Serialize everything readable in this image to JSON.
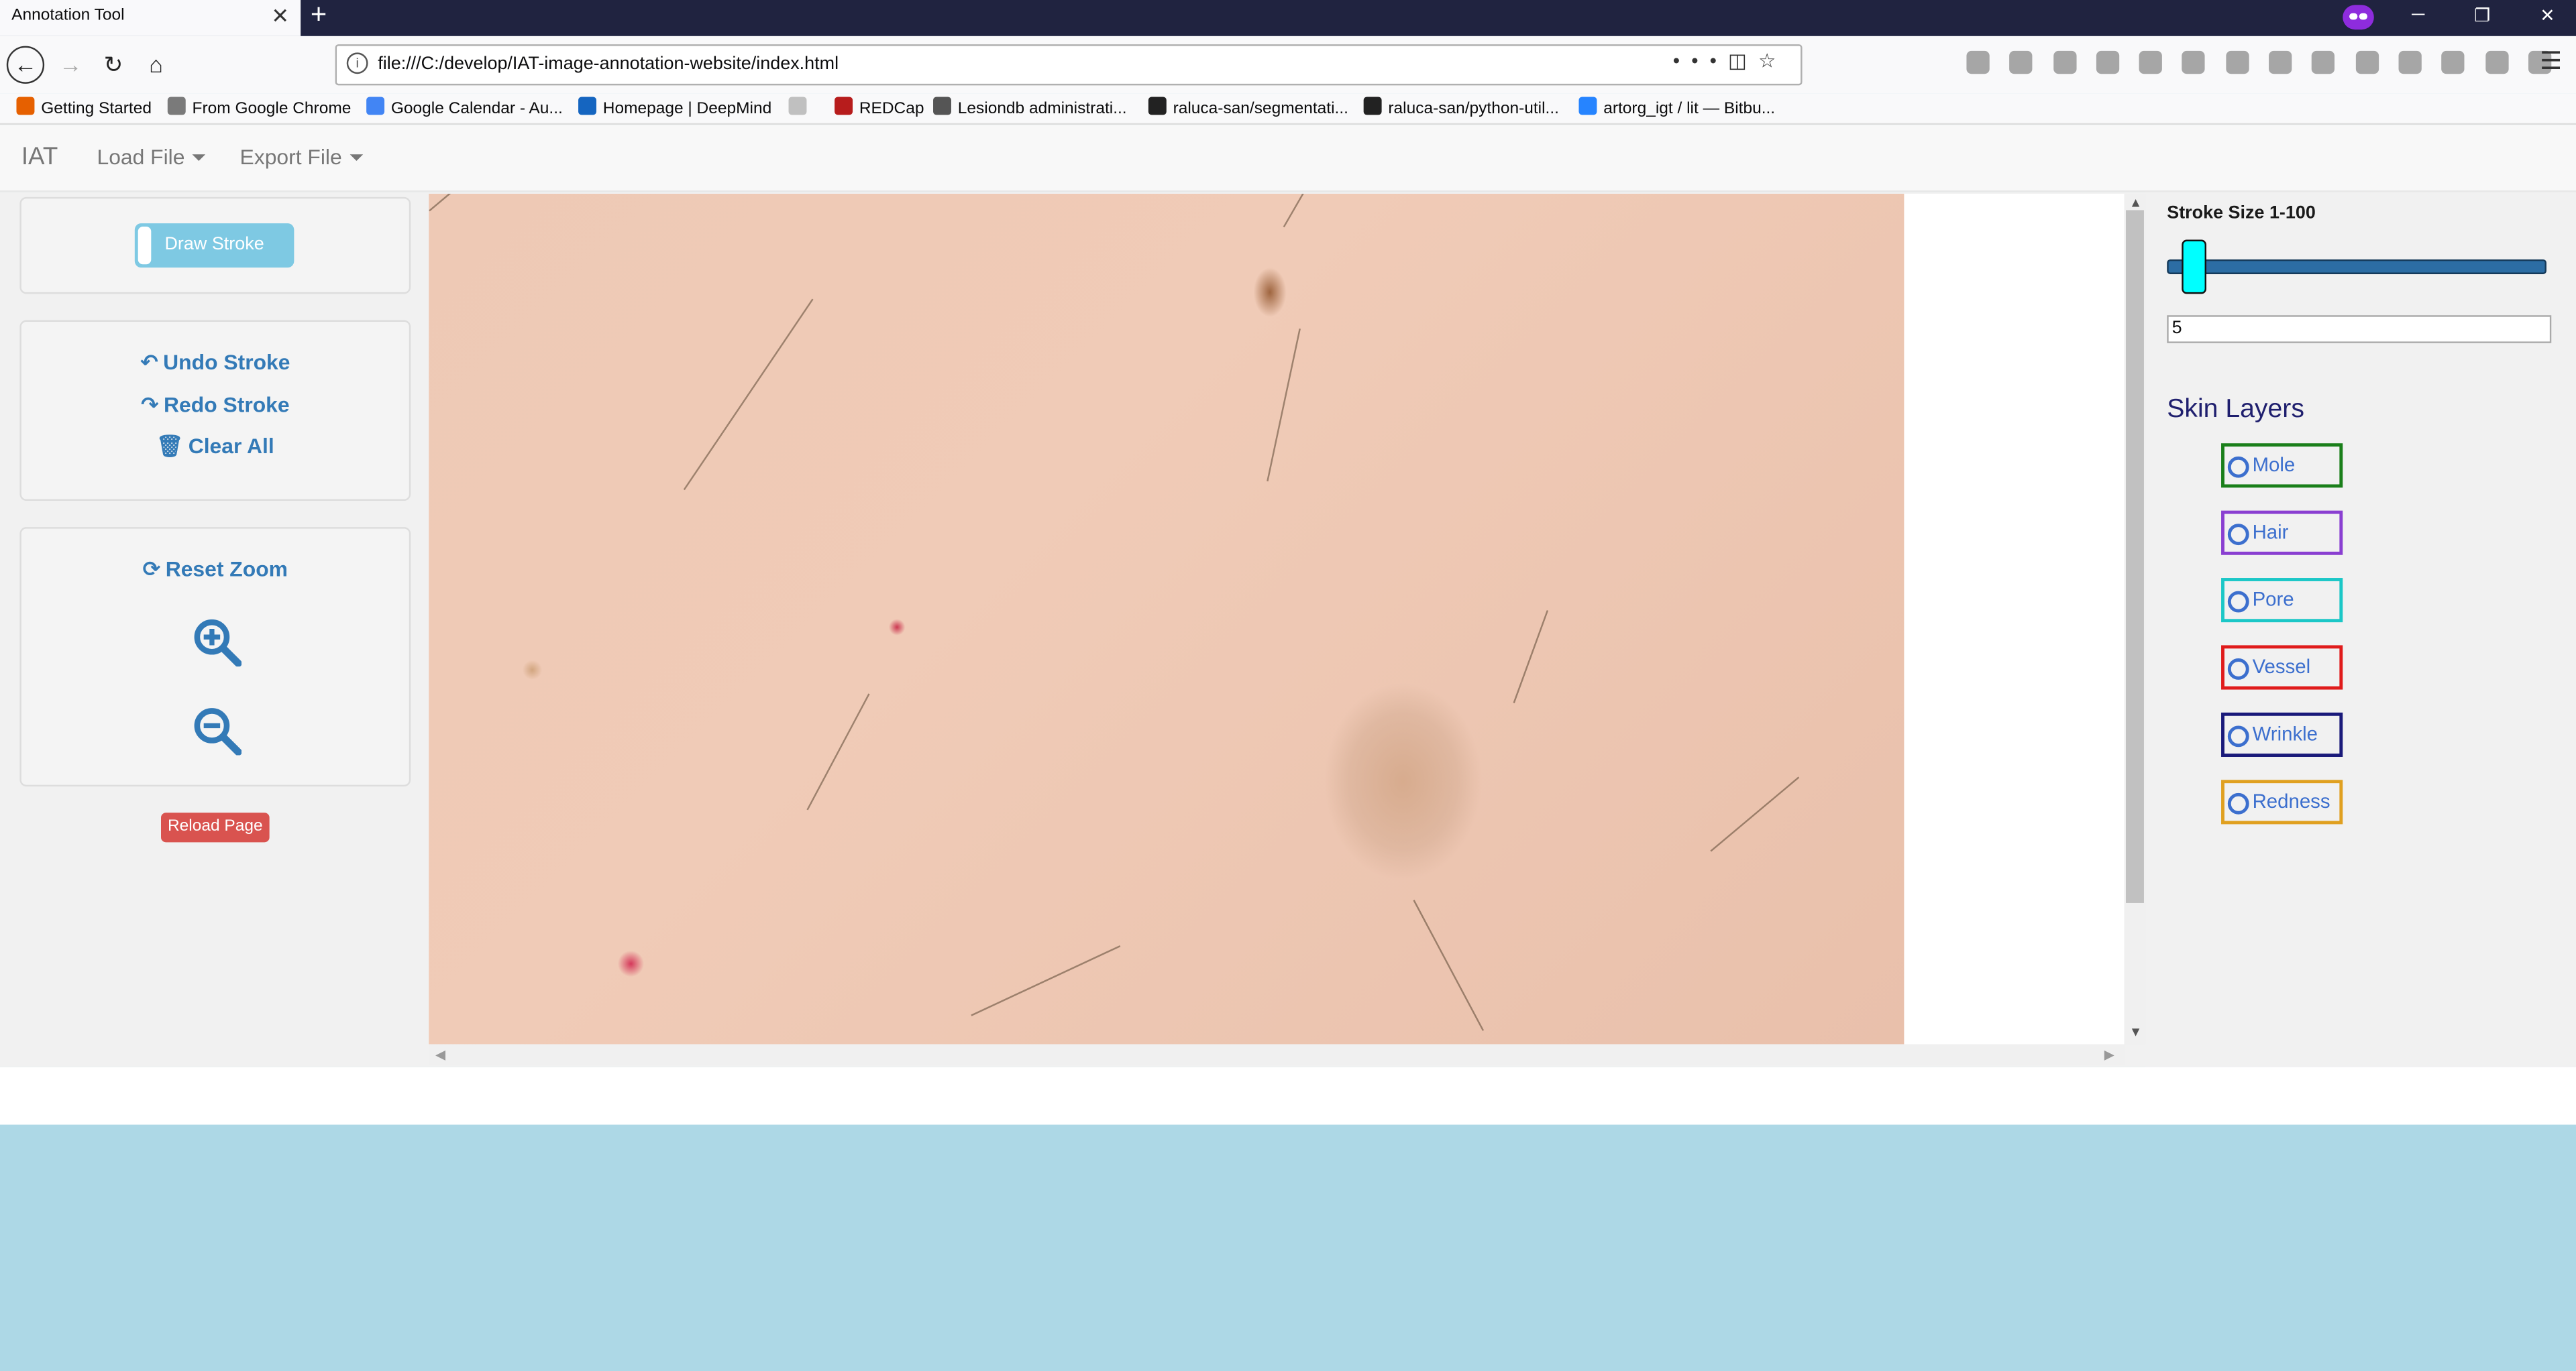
{
  "browser": {
    "tab_title": "Annotation Tool",
    "url": "file:///C:/develop/IAT-image-annotation-website/index.html",
    "bookmarks": [
      {
        "label": "Getting Started",
        "color": "#e66000"
      },
      {
        "label": "From Google Chrome",
        "color": "#7a7a7a"
      },
      {
        "label": "Google Calendar - Au...",
        "color": "#4285f4"
      },
      {
        "label": "Homepage | DeepMind",
        "color": "#1565c0"
      },
      {
        "label": "",
        "color": "#c0c0c0"
      },
      {
        "label": "REDCap",
        "color": "#b71c1c"
      },
      {
        "label": "Lesiondb administrati...",
        "color": "#555555"
      },
      {
        "label": "raluca-san/segmentati...",
        "color": "#222222"
      },
      {
        "label": "raluca-san/python-util...",
        "color": "#222222"
      },
      {
        "label": "artorg_igt / lit — Bitbu...",
        "color": "#2684ff"
      }
    ]
  },
  "app": {
    "brand": "IAT",
    "menu": {
      "load_file": "Load File",
      "export_file": "Export File"
    }
  },
  "left_panel": {
    "draw_stroke": "Draw Stroke",
    "undo_stroke": "Undo Stroke",
    "redo_stroke": "Redo Stroke",
    "clear_all": "Clear All",
    "reset_zoom": "Reset Zoom",
    "reload_page": "Reload Page"
  },
  "right_panel": {
    "stroke_size_label": "Stroke Size 1-100",
    "stroke_size_value": "5",
    "stroke_slider_fraction": 0.04,
    "skin_layers_title": "Skin Layers",
    "layers": [
      {
        "label": "Mole",
        "color": "#1a7f1a"
      },
      {
        "label": "Hair",
        "color": "#8a3fd1"
      },
      {
        "label": "Pore",
        "color": "#1bc7c7"
      },
      {
        "label": "Vessel",
        "color": "#e01b1b"
      },
      {
        "label": "Wrinkle",
        "color": "#1a1a7a"
      },
      {
        "label": "Redness",
        "color": "#e0a020"
      }
    ]
  },
  "colors": {
    "link": "#337ab7",
    "page_background": "#add8e6",
    "reload_button": "#d9534f"
  }
}
